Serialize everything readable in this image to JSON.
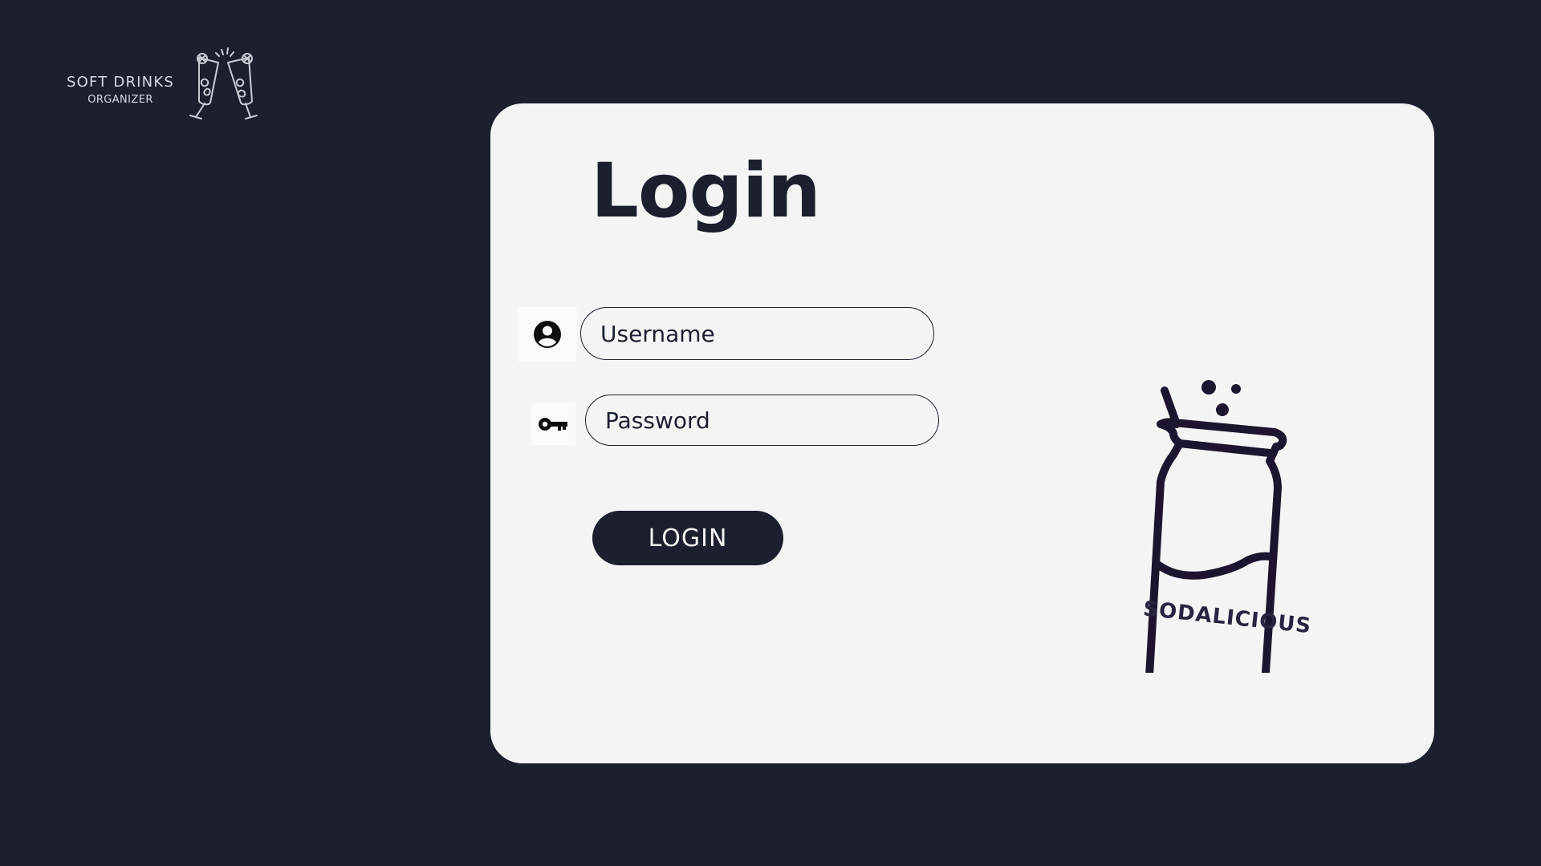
{
  "brand": {
    "line1": "SOFT DRINKS",
    "line2": "ORGANIZER",
    "icon": "toasting-glasses-icon"
  },
  "login": {
    "title": "Login",
    "username": {
      "placeholder": "Username",
      "value": "",
      "icon": "user-circle-icon"
    },
    "password": {
      "placeholder": "Password",
      "value": "",
      "icon": "key-icon"
    },
    "submit_label": "LOGIN"
  },
  "illustration": {
    "icon": "soda-can-icon",
    "label": "SODALICIOUS"
  },
  "colors": {
    "background": "#1b1f2e",
    "card": "#f4f4f4",
    "accent": "#1b1f2e",
    "can_outline": "#1d1530"
  }
}
